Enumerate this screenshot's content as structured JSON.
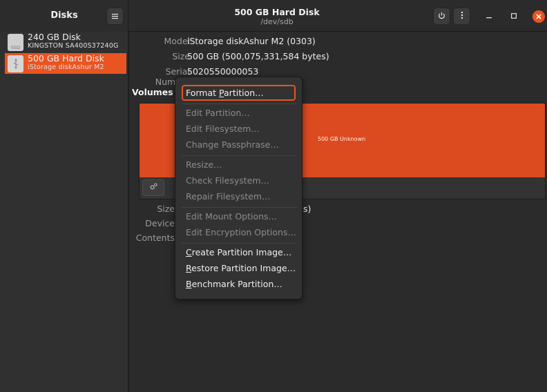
{
  "sidebar_header": {
    "title": "Disks"
  },
  "window": {
    "title": "500 GB Hard Disk",
    "subtitle": "/dev/sdb"
  },
  "disks": [
    {
      "name": "240 GB Disk",
      "model": "KINGSTON SA400S37240G",
      "icon_label": "SSD",
      "selected": false
    },
    {
      "name": "500 GB Hard Disk",
      "model": "iStorage diskAshur M2",
      "icon_label": "",
      "selected": true
    }
  ],
  "details": [
    {
      "key": "Model",
      "value": "iStorage diskAshur M2 (0303)"
    },
    {
      "key": "Size",
      "value": "500 GB (500,075,331,584 bytes)"
    },
    {
      "key": "Serial Number",
      "value": "5020550000053"
    }
  ],
  "volumes": {
    "label": "Volumes",
    "bar_text": "500 GB Unknown",
    "bar_color": "#dc4a1f"
  },
  "lower_fields": [
    {
      "key": "Size",
      "value_fragment": "s)"
    },
    {
      "key": "Device",
      "value_fragment": ""
    },
    {
      "key": "Contents",
      "value_fragment": ""
    }
  ],
  "menu": {
    "group1": [
      {
        "label_pre": "Format ",
        "mnemonic": "P",
        "label_post": "artition…",
        "enabled": true,
        "focused": true
      }
    ],
    "group2": [
      {
        "label": "Edit Partition…",
        "enabled": false
      },
      {
        "label": "Edit Filesystem…",
        "enabled": false
      },
      {
        "label": "Change Passphrase…",
        "enabled": false
      }
    ],
    "group3": [
      {
        "label": "Resize…",
        "enabled": false
      },
      {
        "label": "Check Filesystem…",
        "enabled": false
      },
      {
        "label": "Repair Filesystem…",
        "enabled": false
      }
    ],
    "group4": [
      {
        "label": "Edit Mount Options…",
        "enabled": false
      },
      {
        "label": "Edit Encryption Options…",
        "enabled": false
      }
    ],
    "group5": [
      {
        "mnemonic": "C",
        "label_post": "reate Partition Image…",
        "enabled": true
      },
      {
        "mnemonic": "R",
        "label_post": "estore Partition Image…",
        "enabled": true
      },
      {
        "mnemonic": "B",
        "label_post": "enchmark Partition…",
        "enabled": true
      }
    ]
  },
  "colors": {
    "accent": "#e95420",
    "header_bg": "#2b2b2b",
    "sidebar_bg": "#303030"
  },
  "icons": {
    "sidebar_menu": "hamburger-icon",
    "power": "power-icon",
    "overflow": "kebab-icon",
    "minimize": "minimize-icon",
    "maximize": "maximize-icon",
    "close": "close-icon",
    "gear": "gears-icon",
    "usb": "usb-icon"
  }
}
